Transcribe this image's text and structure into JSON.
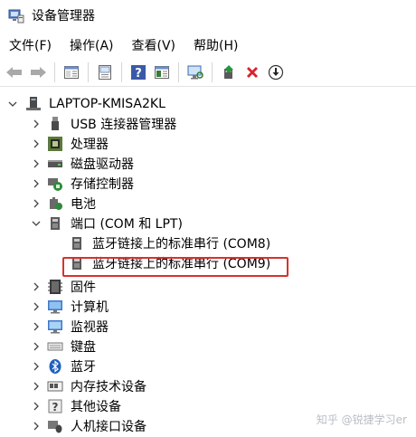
{
  "window": {
    "title": "设备管理器",
    "icon": "device-manager-icon"
  },
  "menu": [
    {
      "label": "文件(F)"
    },
    {
      "label": "操作(A)"
    },
    {
      "label": "查看(V)"
    },
    {
      "label": "帮助(H)"
    }
  ],
  "toolbar": [
    {
      "name": "back-button",
      "icon": "arrow-left-icon"
    },
    {
      "name": "forward-button",
      "icon": "arrow-right-icon"
    },
    {
      "name": "properties-button",
      "icon": "properties-icon"
    },
    {
      "name": "update-button",
      "icon": "device-page-icon"
    },
    {
      "name": "help-button",
      "icon": "help-icon"
    },
    {
      "name": "view-button",
      "icon": "view-icon"
    },
    {
      "name": "scan-button",
      "icon": "monitor-scan-icon"
    },
    {
      "name": "add-driver-button",
      "icon": "driver-update-icon"
    },
    {
      "name": "uninstall-button",
      "icon": "red-x-icon"
    },
    {
      "name": "download-button",
      "icon": "down-circle-icon"
    }
  ],
  "tree": {
    "root": "LAPTOP-KMISA2KL",
    "categories": [
      {
        "label": "USB 连接器管理器",
        "icon": "usb-icon"
      },
      {
        "label": "处理器",
        "icon": "cpu-icon"
      },
      {
        "label": "磁盘驱动器",
        "icon": "disk-icon"
      },
      {
        "label": "存储控制器",
        "icon": "storage-controller-icon"
      },
      {
        "label": "电池",
        "icon": "battery-icon"
      },
      {
        "label": "端口 (COM 和 LPT)",
        "icon": "port-icon",
        "expanded": true,
        "children": [
          {
            "label": "蓝牙链接上的标准串行 (COM8)",
            "icon": "port-icon"
          },
          {
            "label": "蓝牙链接上的标准串行 (COM9)",
            "icon": "port-icon",
            "selected": true
          }
        ]
      },
      {
        "label": "固件",
        "icon": "firmware-icon"
      },
      {
        "label": "计算机",
        "icon": "computer-icon"
      },
      {
        "label": "监视器",
        "icon": "monitor-icon"
      },
      {
        "label": "键盘",
        "icon": "keyboard-icon"
      },
      {
        "label": "蓝牙",
        "icon": "bluetooth-icon"
      },
      {
        "label": "内存技术设备",
        "icon": "memory-icon"
      },
      {
        "label": "其他设备",
        "icon": "unknown-device-icon"
      },
      {
        "label": "人机接口设备",
        "icon": "hid-icon"
      }
    ]
  },
  "watermark": "知乎 @锐捷学习er",
  "colors": {
    "selection_border": "#d9312d",
    "uninstall_red": "#d8232a",
    "help_blue": "#3a5aa8"
  }
}
